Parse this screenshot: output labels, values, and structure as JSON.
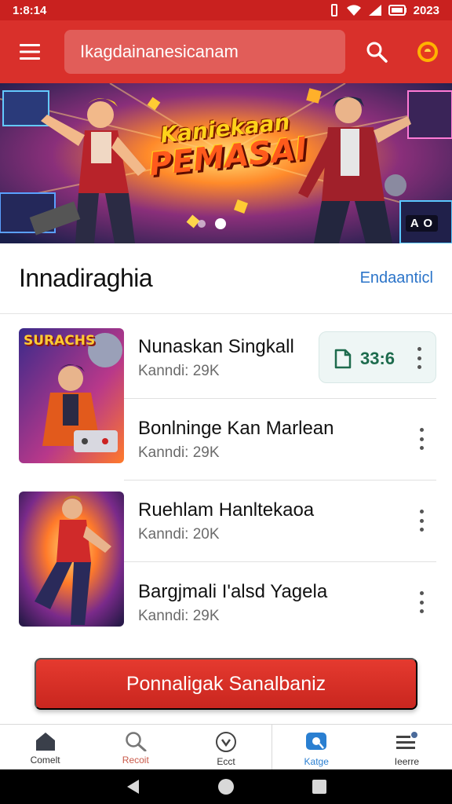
{
  "status_bar": {
    "time": "1:8:14",
    "battery_text": "2023"
  },
  "app_bar": {
    "search_text": "Ikagdainanesicanam",
    "menu_icon": "hamburger-icon",
    "search_icon": "search-icon",
    "coin_icon": "coin-icon"
  },
  "banner": {
    "title_line1": "Kaniekaan",
    "title_line2": "PEMASAI",
    "badge": "A O",
    "slide_count": 2,
    "active_slide": 2
  },
  "section": {
    "title": "Innadiraghia",
    "link": "Endaanticl"
  },
  "items": [
    {
      "title": "Nunaskan Singkall",
      "subtitle": "Kanndi: 29K",
      "size": "33:6",
      "thumb_text": "SURACHS"
    },
    {
      "title": "Bonlninge Kan Marlean",
      "subtitle": "Kanndi: 29K"
    },
    {
      "title": "Ruehlam Hanltekaoa",
      "subtitle": "Kanndi: 20K"
    },
    {
      "title": "Bargjmali I'alsd Yagela",
      "subtitle": "Kanndi: 29K"
    }
  ],
  "cta": {
    "label": "Ponnaligak Sanalbaniz"
  },
  "bottom_nav": [
    {
      "label": "Comelt",
      "icon": "home-icon"
    },
    {
      "label": "Recoit",
      "icon": "search-icon"
    },
    {
      "label": "Ecct",
      "icon": "chevron-circle-icon"
    },
    {
      "label": "Katge",
      "icon": "chat-icon",
      "active": true
    },
    {
      "label": "Ieerre",
      "icon": "menu-profile-icon"
    }
  ],
  "colors": {
    "brand_red": "#d9302b",
    "status_red": "#c9211f",
    "link_blue": "#2b74c9",
    "chip_green": "#1d6b4d"
  }
}
